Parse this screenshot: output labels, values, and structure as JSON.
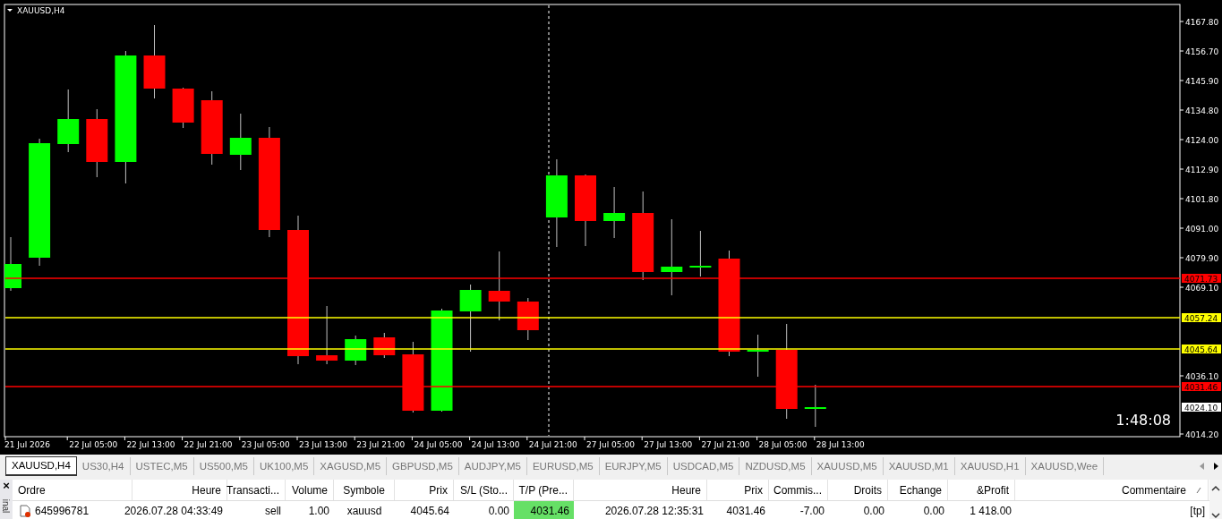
{
  "chart": {
    "title": "XAUUSD,H4",
    "countdown": "1:48:08",
    "price_axis": [
      "4167.80",
      "4156.70",
      "4145.90",
      "4134.80",
      "4124.00",
      "4112.90",
      "4101.80",
      "4091.00",
      "4079.90",
      "4069.10",
      "4036.10",
      "4014.20"
    ],
    "time_axis": [
      "21 Jul 2026",
      "22 Jul 05:00",
      "22 Jul 13:00",
      "22 Jul 21:00",
      "23 Jul 05:00",
      "23 Jul 13:00",
      "23 Jul 21:00",
      "24 Jul 05:00",
      "24 Jul 13:00",
      "24 Jul 21:00",
      "27 Jul 05:00",
      "27 Jul 13:00",
      "27 Jul 21:00",
      "28 Jul 05:00",
      "28 Jul 13:00"
    ],
    "levels": [
      {
        "label": "4071.73",
        "color": "#ff0000"
      },
      {
        "label": "4057.24",
        "color": "#ffff00"
      },
      {
        "label": "4045.64",
        "color": "#ffff00"
      },
      {
        "label": "4031.46",
        "color": "#ff0000"
      }
    ],
    "current_price": "4024.10"
  },
  "tabs": [
    {
      "label": "XAUUSD,H4",
      "selected": true
    },
    {
      "label": "US30,H4",
      "selected": false
    },
    {
      "label": "USTEC,M5",
      "selected": false
    },
    {
      "label": "US500,M5",
      "selected": false
    },
    {
      "label": "UK100,M5",
      "selected": false
    },
    {
      "label": "XAGUSD,M5",
      "selected": false
    },
    {
      "label": "GBPUSD,M5",
      "selected": false
    },
    {
      "label": "AUDJPY,M5",
      "selected": false
    },
    {
      "label": "EURUSD,M5",
      "selected": false
    },
    {
      "label": "EURJPY,M5",
      "selected": false
    },
    {
      "label": "USDCAD,M5",
      "selected": false
    },
    {
      "label": "NZDUSD,M5",
      "selected": false
    },
    {
      "label": "XAUUSD,M5",
      "selected": false
    },
    {
      "label": "XAUUSD,M1",
      "selected": false
    },
    {
      "label": "XAUUSD,H1",
      "selected": false
    },
    {
      "label": "XAUUSD,Wee",
      "selected": false
    }
  ],
  "terminal": {
    "close": "×",
    "side_label": "inal",
    "columns": [
      {
        "label": "Ordre",
        "sorted": false
      },
      {
        "label": "Heure",
        "sorted": false
      },
      {
        "label": "Transacti...",
        "sorted": false
      },
      {
        "label": "Volume",
        "sorted": false
      },
      {
        "label": "Symbole",
        "sorted": false
      },
      {
        "label": "Prix",
        "sorted": false
      },
      {
        "label": "S/L (Sto...",
        "sorted": false
      },
      {
        "label": "T/P (Pre...",
        "sorted": false
      },
      {
        "label": "Heure",
        "sorted": false
      },
      {
        "label": "Prix",
        "sorted": false
      },
      {
        "label": "Commis...",
        "sorted": false
      },
      {
        "label": "Droits",
        "sorted": false
      },
      {
        "label": "Echange",
        "sorted": false
      },
      {
        "label": "&Profit",
        "sorted": false
      },
      {
        "label": "Commentaire",
        "sorted": true
      }
    ],
    "rows": [
      {
        "cells": [
          {
            "text": "645996781",
            "highlighted": false
          },
          {
            "text": "2026.07.28 04:33:49",
            "highlighted": false
          },
          {
            "text": "sell",
            "highlighted": false
          },
          {
            "text": "1.00",
            "highlighted": false
          },
          {
            "text": "xauusd",
            "highlighted": false
          },
          {
            "text": "4045.64",
            "highlighted": false
          },
          {
            "text": "0.00",
            "highlighted": false
          },
          {
            "text": "4031.46",
            "highlighted": true
          },
          {
            "text": "2026.07.28 12:35:31",
            "highlighted": false
          },
          {
            "text": "4031.46",
            "highlighted": false
          },
          {
            "text": "-7.00",
            "highlighted": false
          },
          {
            "text": "0.00",
            "highlighted": false
          },
          {
            "text": "0.00",
            "highlighted": false
          },
          {
            "text": "1 418.00",
            "highlighted": false
          },
          {
            "text": "[tp]",
            "highlighted": false
          }
        ]
      }
    ]
  }
}
